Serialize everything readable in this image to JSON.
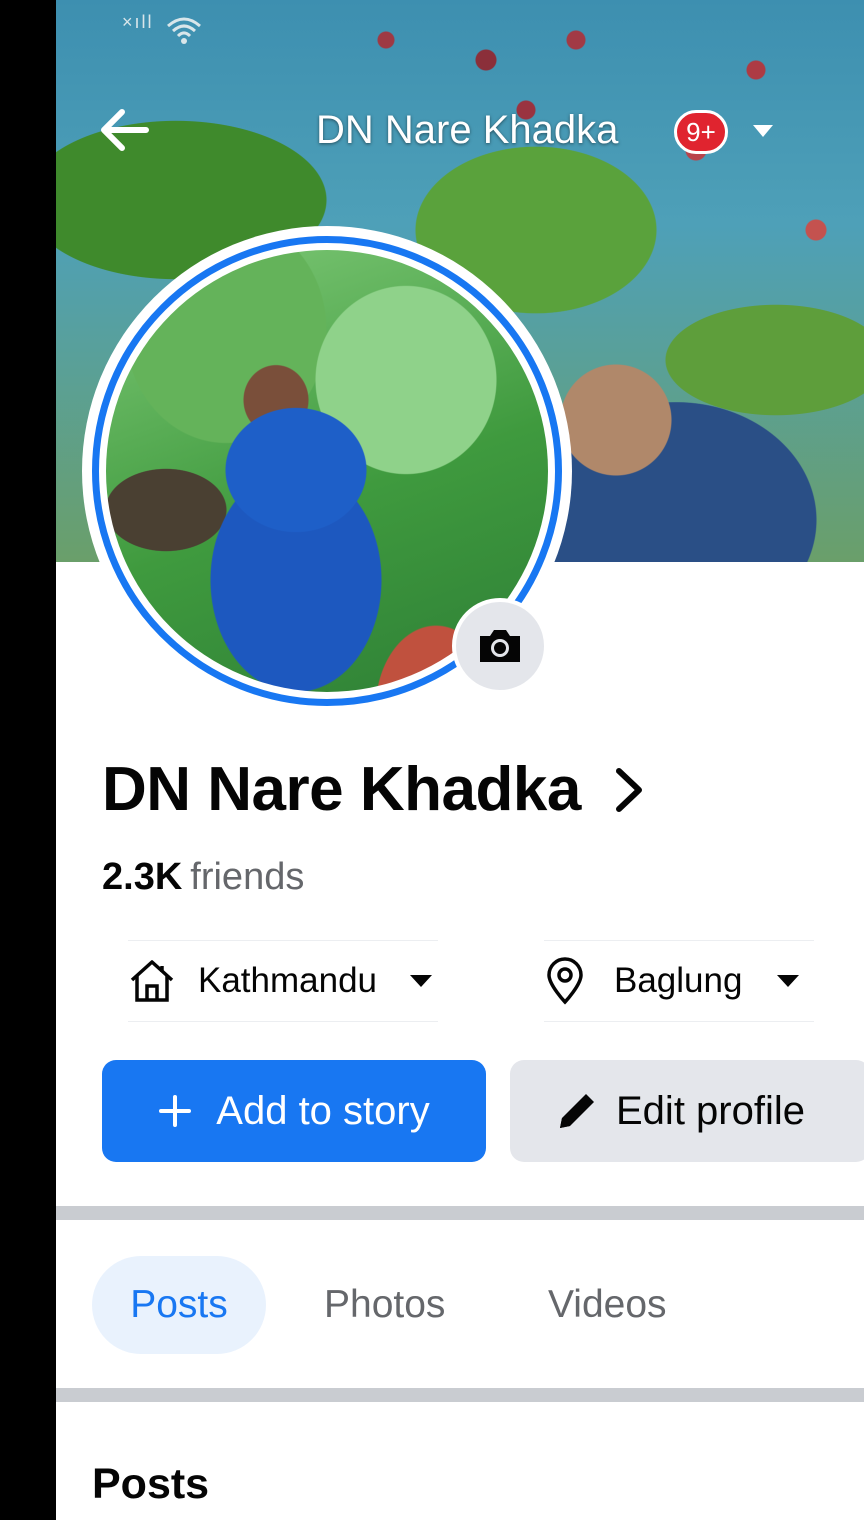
{
  "status_bar": {
    "signal_text": "×ıll"
  },
  "header": {
    "title": "DN Nare Khadka",
    "notification_badge": "9+"
  },
  "profile": {
    "name": "DN Nare Khadka",
    "friends_count": "2.3K",
    "friends_label": "friends"
  },
  "details": [
    {
      "icon": "home-icon",
      "label": "Kathmandu"
    },
    {
      "icon": "location-pin-icon",
      "label": "Baglung"
    }
  ],
  "actions": {
    "add_to_story": "Add to story",
    "edit_profile": "Edit profile"
  },
  "tabs": [
    {
      "label": "Posts",
      "active": true
    },
    {
      "label": "Photos",
      "active": false
    },
    {
      "label": "Videos",
      "active": false
    }
  ],
  "section": {
    "heading": "Posts"
  },
  "colors": {
    "accent": "#1877f2",
    "badge": "#e0242f",
    "secondary_button": "#e4e6eb"
  }
}
